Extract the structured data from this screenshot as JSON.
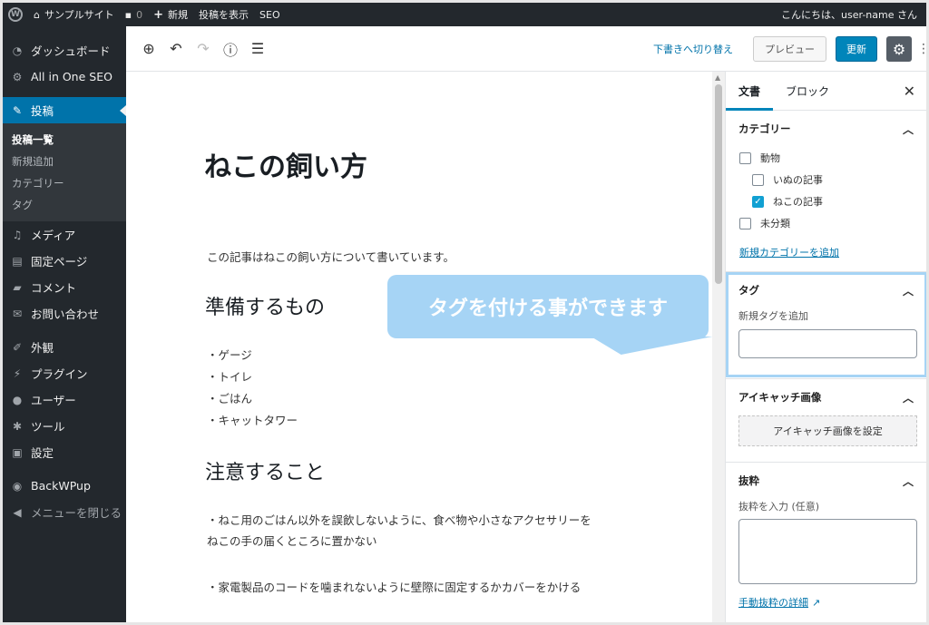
{
  "adminbar": {
    "site_name": "サンプルサイト",
    "comments_count": "0",
    "new_label": "新規",
    "view_post": "投稿を表示",
    "seo": "SEO",
    "greeting": "こんにちは、user-name さん"
  },
  "sidebar": {
    "dashboard": "ダッシュボード",
    "aioseo": "All in One SEO",
    "posts": "投稿",
    "sub": [
      "投稿一覧",
      "新規追加",
      "カテゴリー",
      "タグ"
    ],
    "media": "メディア",
    "pages": "固定ページ",
    "comments": "コメント",
    "contact": "お問い合わせ",
    "appearance": "外観",
    "plugins": "プラグイン",
    "users": "ユーザー",
    "tools": "ツール",
    "settings": "設定",
    "backwpup": "BackWPup",
    "collapse": "メニューを閉じる"
  },
  "toolbar": {
    "switch_draft": "下書きへ切り替え",
    "preview": "プレビュー",
    "update": "更新"
  },
  "post": {
    "title": "ねこの飼い方",
    "intro": "この記事はねこの飼い方について書いています。",
    "h1": "準備するもの",
    "items": [
      "・ゲージ",
      "・トイレ",
      "・ごはん",
      "・キャットタワー"
    ],
    "h2": "注意すること",
    "note1a": "・ねこ用のごはん以外を誤飲しないように、食べ物や小さなアクセサリーを",
    "note1b": "ねこの手の届くところに置かない",
    "note2": "・家電製品のコードを噛まれないように壁際に固定するかカバーをかける"
  },
  "panel": {
    "tab_document": "文書",
    "tab_block": "ブロック",
    "categories_title": "カテゴリー",
    "categories": [
      {
        "label": "動物",
        "checked": false,
        "indent": 0
      },
      {
        "label": "いぬの記事",
        "checked": false,
        "indent": 1
      },
      {
        "label": "ねこの記事",
        "checked": true,
        "indent": 1
      },
      {
        "label": "未分類",
        "checked": false,
        "indent": 0
      }
    ],
    "add_category": "新規カテゴリーを追加",
    "tags_title": "タグ",
    "add_tag_label": "新規タグを追加",
    "featured_title": "アイキャッチ画像",
    "featured_button": "アイキャッチ画像を設定",
    "excerpt_title": "抜粋",
    "excerpt_label": "抜粋を入力 (任意)",
    "excerpt_link": "手動抜粋の詳細"
  },
  "callout": {
    "text": "タグを付ける事ができます"
  }
}
